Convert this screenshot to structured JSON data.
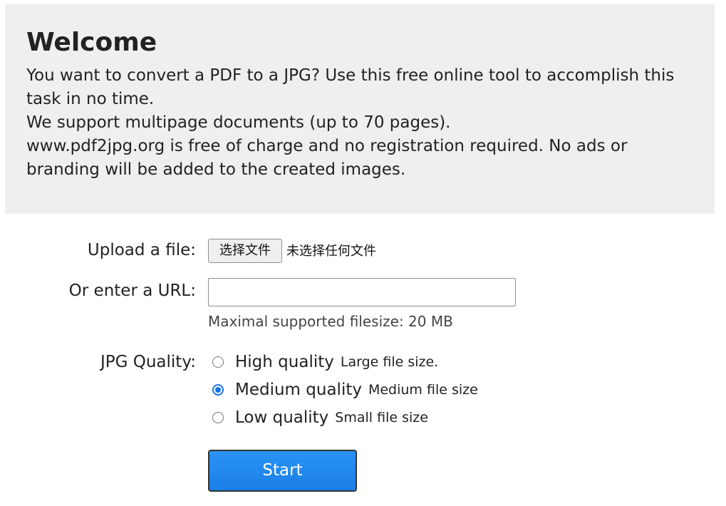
{
  "welcome": {
    "title": "Welcome",
    "lines": [
      "You want to convert a PDF to a JPG? Use this free online tool to accomplish this task in no time.",
      "We support multipage documents (up to 70 pages).",
      "www.pdf2jpg.org is free of charge and no registration required. No ads or branding will be added to the created images."
    ]
  },
  "upload": {
    "label": "Upload a file:",
    "button_label": "选择文件",
    "status": "未选择任何文件"
  },
  "url": {
    "label": "Or enter a URL:",
    "value": "",
    "hint": "Maximal supported filesize: 20 MB"
  },
  "quality": {
    "label": "JPG Quality:",
    "options": [
      {
        "label": "High quality",
        "note": "Large file size.",
        "checked": false
      },
      {
        "label": "Medium quality",
        "note": "Medium file size",
        "checked": true
      },
      {
        "label": "Low quality",
        "note": "Small file size",
        "checked": false
      }
    ]
  },
  "start_button": {
    "label": "Start",
    "color": "#1a7fe6"
  }
}
